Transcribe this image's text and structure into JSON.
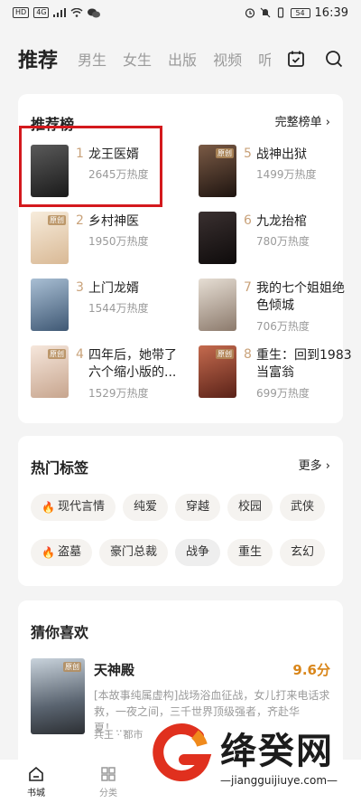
{
  "status_bar": {
    "left_chips": [
      "HD",
      "4G"
    ],
    "battery": "54",
    "time": "16:39"
  },
  "top_nav": {
    "tabs": [
      "推荐",
      "男生",
      "女生",
      "出版",
      "视频",
      "听书"
    ],
    "icons": [
      "calendar-check-icon",
      "search-icon"
    ]
  },
  "ranking": {
    "title": "推荐榜",
    "more": "完整榜单 ›",
    "books": [
      {
        "rank": "1",
        "name": "龙王医婿",
        "heat": "2645万热度",
        "cover_color": "#2b2b2b"
      },
      {
        "rank": "2",
        "name": "乡村神医",
        "heat": "1950万热度",
        "cover_color": "#f0e2cf"
      },
      {
        "rank": "3",
        "name": "上门龙婿",
        "heat": "1544万热度",
        "cover_color": "#7f98b3"
      },
      {
        "rank": "4",
        "name": "四年后，她带了六个缩小版的...",
        "heat": "1529万热度",
        "cover_color": "#e9d6c7"
      },
      {
        "rank": "5",
        "name": "战神出狱",
        "heat": "1499万热度",
        "cover_color": "#3a2a22"
      },
      {
        "rank": "6",
        "name": "九龙抬棺",
        "heat": "780万热度",
        "cover_color": "#1f1a1a"
      },
      {
        "rank": "7",
        "name": "我的七个姐姐绝色倾城",
        "heat": "706万热度",
        "cover_color": "#c9c2b8"
      },
      {
        "rank": "8",
        "name": "重生：回到1983当富翁",
        "heat": "699万热度",
        "cover_color": "#8a3a2c"
      }
    ],
    "cover_badge": "原创"
  },
  "tags": {
    "title": "热门标签",
    "more": "更多 ›",
    "row1": [
      "现代言情",
      "纯爱",
      "穿越",
      "校园",
      "武侠"
    ],
    "row2": [
      "盗墓",
      "豪门总裁",
      "战争",
      "重生",
      "玄幻"
    ]
  },
  "guess": {
    "title": "猜你喜欢",
    "book": {
      "name": "天神殿",
      "score": "9.6分",
      "desc": "[本故事纯属虚构]战场浴血征战，女儿打来电话求救，一夜之间，三千世界顶级强者，齐赴华夏！...",
      "meta": "兵王 · 都市",
      "badge": "原创"
    }
  },
  "bottom_nav": {
    "items": [
      "书城",
      "分类"
    ]
  },
  "watermark": {
    "title": "绛癸网",
    "domain": "—jiangguijiuye.com—"
  },
  "colors": {
    "accent": "#c9a27a",
    "score": "#d9861a",
    "highlight": "#d4191d"
  }
}
